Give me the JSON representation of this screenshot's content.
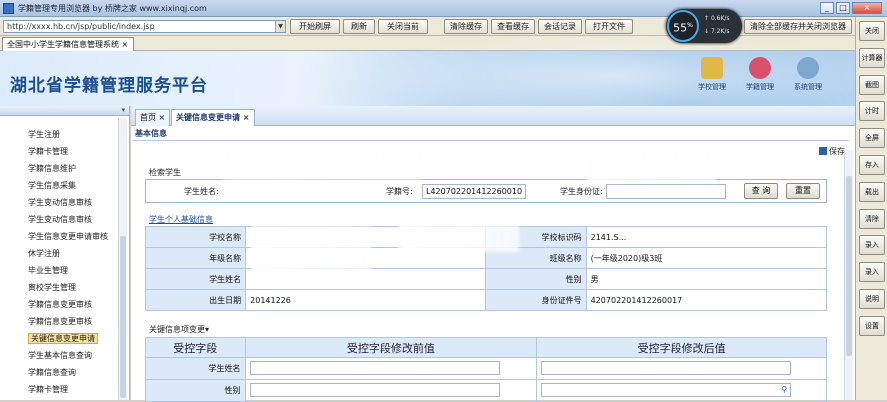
{
  "browser": {
    "title": "学籍管理专用浏览器 by 桥牌之家 www.xixinqj.com",
    "url": "http://xxxx.hb.cn/jsp/public/index.jsp",
    "toolbar_buttons": [
      "开始刷屏",
      "刷新",
      "关闭当前",
      "清除缓存",
      "查看缓存",
      "会话记录",
      "打开文件",
      "清除全部缓存并关闭浏览器"
    ],
    "tab_label": "全国中小学生学籍信息管理系统",
    "window_controls": [
      "_",
      "□",
      "×"
    ],
    "right_buttons": [
      "关闭",
      "计算器",
      "截图",
      "计时",
      "全屏",
      "存入",
      "载出",
      "清除",
      "录入",
      "录入",
      "说明",
      "设置"
    ]
  },
  "speed_widget": {
    "percent": "55",
    "percent_unit": "%",
    "up": "0.6K/s",
    "down": "7.2K/s"
  },
  "banner": {
    "title": "湖北省学籍管理服务平台",
    "icons": [
      {
        "label": "学校管理",
        "icon": "school-icon",
        "color": "#e0b84a"
      },
      {
        "label": "学籍管理",
        "icon": "student-icon",
        "color": "#d8506a"
      },
      {
        "label": "系统管理",
        "icon": "system-icon",
        "color": "#7fa6cf"
      }
    ]
  },
  "sidebar": {
    "items": [
      "学生注册",
      "学籍卡管理",
      "学籍信息维护",
      "学生信息采集",
      "学生变动信息审核",
      "学生变动信息审核",
      "学生信息变更申请审核",
      "休学注册",
      "毕业生管理",
      "离校学生管理",
      "学籍信息变更审核",
      "学籍信息变更审核",
      "关键信息变更申请",
      "学生基本信息查询",
      "学籍信息查询",
      "学籍卡管理"
    ],
    "selected_index": 12
  },
  "main": {
    "tabs": [
      {
        "label": "首页",
        "close": "×"
      },
      {
        "label": "关键信息变更申请",
        "close": "×"
      }
    ],
    "breadcrumb": "基本信息",
    "save_label": "保存",
    "search_section": "检索学生",
    "search": {
      "name_label": "学生姓名:",
      "name_value": "",
      "id_label": "学籍号:",
      "id_value": "L420702201412260010",
      "school_label": "学生身份证:",
      "school_value": "",
      "query_label": "查 询",
      "reset_label": "重置"
    },
    "info_section": "学生个人基础信息",
    "info_rows": [
      {
        "k1": "学校名称",
        "v1": "",
        "k2": "学校标识码",
        "v2": "2141.S..."
      },
      {
        "k1": "年级名称",
        "v1": "",
        "k2": "班级名称",
        "v2": "(一年级2020)级3班"
      },
      {
        "k1": "学生姓名",
        "v1": "",
        "k2": "性别",
        "v2": "男"
      },
      {
        "k1": "出生日期",
        "v1": "20141226",
        "k2": "身份证件号",
        "v2": "420702201412260017"
      }
    ],
    "fields_section": "关键信息项变更",
    "fields_header": [
      "受控字段",
      "受控字段修改前值",
      "受控字段修改后值"
    ],
    "fields_rows": [
      {
        "label": "学生姓名",
        "before": "",
        "after": ""
      },
      {
        "label": "性别",
        "before": "",
        "after": ""
      }
    ]
  }
}
